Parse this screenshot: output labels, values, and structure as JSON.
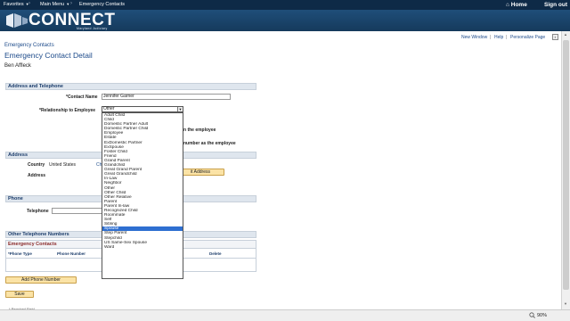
{
  "topbar": {
    "menus": [
      "Favorites",
      "Main Menu"
    ],
    "separator": "›",
    "current": "Emergency Contacts",
    "home": "Home",
    "signout": "Sign out"
  },
  "brand": {
    "name": "CONNECT",
    "sub": "Maryland Judiciary"
  },
  "pagelinks": [
    "New Window",
    "Help",
    "Personalize Page"
  ],
  "pagelink_sep": "|",
  "breadcrumb": "Emergency Contacts",
  "title": "Emergency Contact Detail",
  "person": "Ben Affleck",
  "sections": {
    "address_phone": "Address and Telephone",
    "address": "Address",
    "phone": "Phone",
    "other_phones": "Other Telephone Numbers"
  },
  "fields": {
    "contact_name_label": "*Contact Name",
    "contact_name_value": "Jennifer Garner",
    "relationship_label": "*Relationship to Employee",
    "relationship_value": "Other",
    "same_address_tail": "n the employee",
    "same_phone_tail": "number as the employee",
    "country_label": "Country",
    "country_value": "United States",
    "country_link_fragment": "Ch",
    "address_label": "Address",
    "edit_address_btn": "it Address",
    "telephone_label": "Telephone"
  },
  "grid": {
    "title": "Emergency Contacts",
    "columns": [
      "*Phone Type",
      "Phone Number",
      "Delete"
    ]
  },
  "buttons": {
    "add_phone": "Add Phone Number",
    "save": "Save"
  },
  "required_note": "* Required Field",
  "relationship_options": [
    "Adult Child",
    "Child",
    "Domestic Partner Adult",
    "Domestic Partner Child",
    "Employee",
    "Estate",
    "ExDomestic Partner",
    "ExSpouse",
    "Foster Child",
    "Friend",
    "Grand Parent",
    "Grandchild",
    "Great Grand Parent",
    "Great Grandchild",
    "In-Law",
    "Neighbor",
    "Other",
    "Other Child",
    "Other Relative",
    "Parent",
    "Parent In-law",
    "Recognized Child",
    "Roommate",
    "Self",
    "Sibling",
    "Spouse",
    "Step Parent",
    "Stepchild",
    "US Same-Sex Spouse",
    "Ward"
  ],
  "relationship_highlighted": "Spouse",
  "status": {
    "zoom": "90%"
  },
  "icons": {
    "home": "home-icon",
    "zoom": "zoom-icon",
    "close": "close-icon"
  }
}
